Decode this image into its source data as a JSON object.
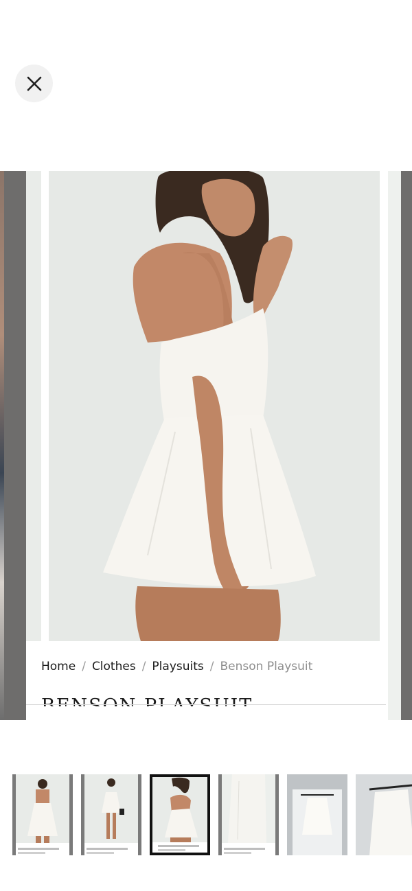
{
  "close": {
    "icon": "close-icon"
  },
  "breadcrumb": {
    "items": [
      "Home",
      "Clothes",
      "Playsuits",
      "Benson Playsuit"
    ],
    "separator": "/"
  },
  "product": {
    "title": "BENSON PLAYSUIT"
  },
  "thumbnails": [
    {
      "name": "front-view"
    },
    {
      "name": "full-body-view"
    },
    {
      "name": "back-view",
      "active": true
    },
    {
      "name": "detail-view"
    },
    {
      "name": "hanger-photo-1"
    },
    {
      "name": "hanger-photo-2"
    }
  ],
  "colors": {
    "dress": "#f7f5f0",
    "backdrop": "#e6e9e6",
    "overlay": "#6e6d6c"
  }
}
